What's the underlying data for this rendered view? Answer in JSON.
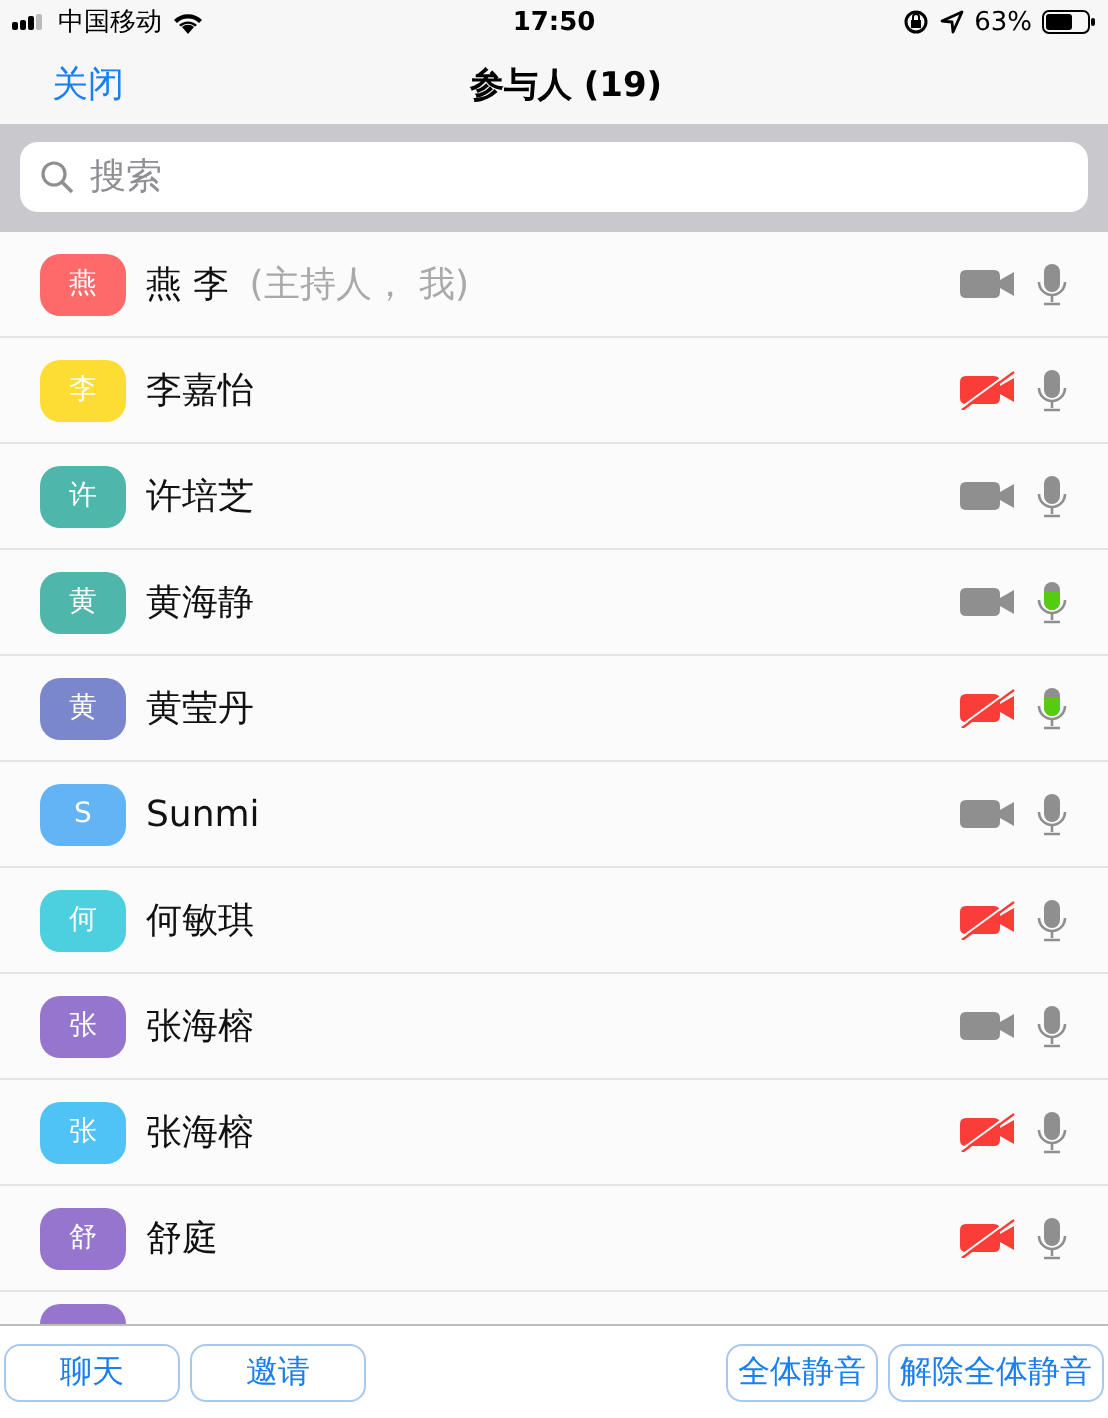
{
  "status_bar": {
    "carrier": "中国移动",
    "time": "17:50",
    "battery": "63%"
  },
  "nav": {
    "close": "关闭",
    "title": "参与人 (19)"
  },
  "search": {
    "placeholder": "搜索"
  },
  "participants": [
    {
      "avatar": "燕",
      "name": "燕 李",
      "note": "(主持人， 我)",
      "color": "#fe6a6a",
      "video_off": false,
      "speaking": false
    },
    {
      "avatar": "李",
      "name": "李嘉怡",
      "color": "#fddd33",
      "video_off": true,
      "speaking": false
    },
    {
      "avatar": "许",
      "name": "许培芝",
      "color": "#4fb6ab",
      "video_off": false,
      "speaking": false
    },
    {
      "avatar": "黄",
      "name": "黄海静",
      "color": "#4fb6ab",
      "video_off": false,
      "speaking": true
    },
    {
      "avatar": "黄",
      "name": "黄莹丹",
      "color": "#7a87cc",
      "video_off": true,
      "speaking": true
    },
    {
      "avatar": "S",
      "name": "Sunmi",
      "color": "#63b4f5",
      "video_off": false,
      "speaking": false
    },
    {
      "avatar": "何",
      "name": "何敏琪",
      "color": "#4cd0e0",
      "video_off": true,
      "speaking": false
    },
    {
      "avatar": "张",
      "name": "张海榕",
      "color": "#9575cd",
      "video_off": false,
      "speaking": false
    },
    {
      "avatar": "张",
      "name": "张海榕",
      "color": "#4fc2f6",
      "video_off": true,
      "speaking": false
    },
    {
      "avatar": "舒",
      "name": "舒庭",
      "color": "#9575cd",
      "video_off": true,
      "speaking": false
    }
  ],
  "next_participant": {
    "color": "#9575cd"
  },
  "toolbar": {
    "left": [
      "聊天",
      "邀请"
    ],
    "right": [
      "全体静音",
      "解除全体静音"
    ]
  }
}
